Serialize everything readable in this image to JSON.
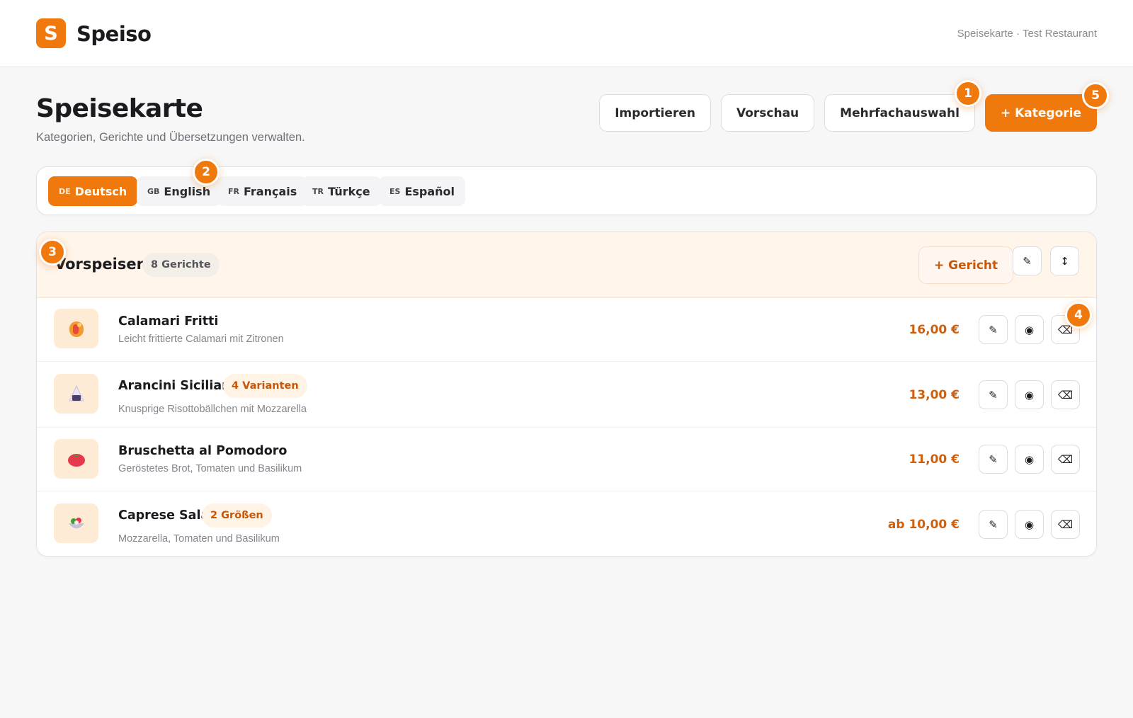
{
  "app": {
    "logo_letter": "S",
    "name": "Speiso",
    "context": "Speisekarte · Test Restaurant"
  },
  "header": {
    "title": "Speisekarte",
    "subtitle": "Kategorien, Gerichte und Übersetzungen verwalten."
  },
  "actions": {
    "import": "Importieren",
    "preview": "Vorschau",
    "multi_select": "Mehrfachauswahl",
    "add_category": "+ Kategorie"
  },
  "tour_badges": [
    "1",
    "2",
    "3",
    "4",
    "5"
  ],
  "languages": [
    {
      "code": "DE",
      "label": "Deutsch",
      "active": true
    },
    {
      "code": "GB",
      "label": "English",
      "active": false
    },
    {
      "code": "FR",
      "label": "Français",
      "active": false
    },
    {
      "code": "TR",
      "label": "Türkçe",
      "active": false
    },
    {
      "code": "ES",
      "label": "Español",
      "active": false
    }
  ],
  "category": {
    "title": "Vorspeisen",
    "count": "8 Gerichte",
    "add_dish": "+ Gericht",
    "edit_icon": "✎",
    "reorder_icon": "↕"
  },
  "dishes": [
    {
      "name": "Calamari Fritti",
      "tag": "",
      "desc": "Leicht frittierte Calamari mit Zitronen",
      "price": "16,00 €",
      "icon": "calamari-icon"
    },
    {
      "name": "Arancini Siciliani",
      "tag": "4 Varianten",
      "desc": "Knusprige Risottobällchen mit Mozzarella",
      "price": "13,00 €",
      "icon": "onigiri-icon"
    },
    {
      "name": "Bruschetta al Pomodoro",
      "tag": "",
      "desc": "Geröstetes Brot, Tomaten und Basilikum",
      "price": "11,00 €",
      "icon": "tomato-icon"
    },
    {
      "name": "Caprese Salat",
      "tag": "2 Größen",
      "desc": "Mozzarella, Tomaten und Basilikum",
      "price": "ab 10,00 €",
      "icon": "salad-icon"
    }
  ],
  "row_icons": {
    "edit": "✎",
    "visibility": "◉",
    "delete": "⌫"
  },
  "colors": {
    "accent": "#f0790e",
    "price": "#d15f0a",
    "category_bg": "#fff5eb"
  }
}
